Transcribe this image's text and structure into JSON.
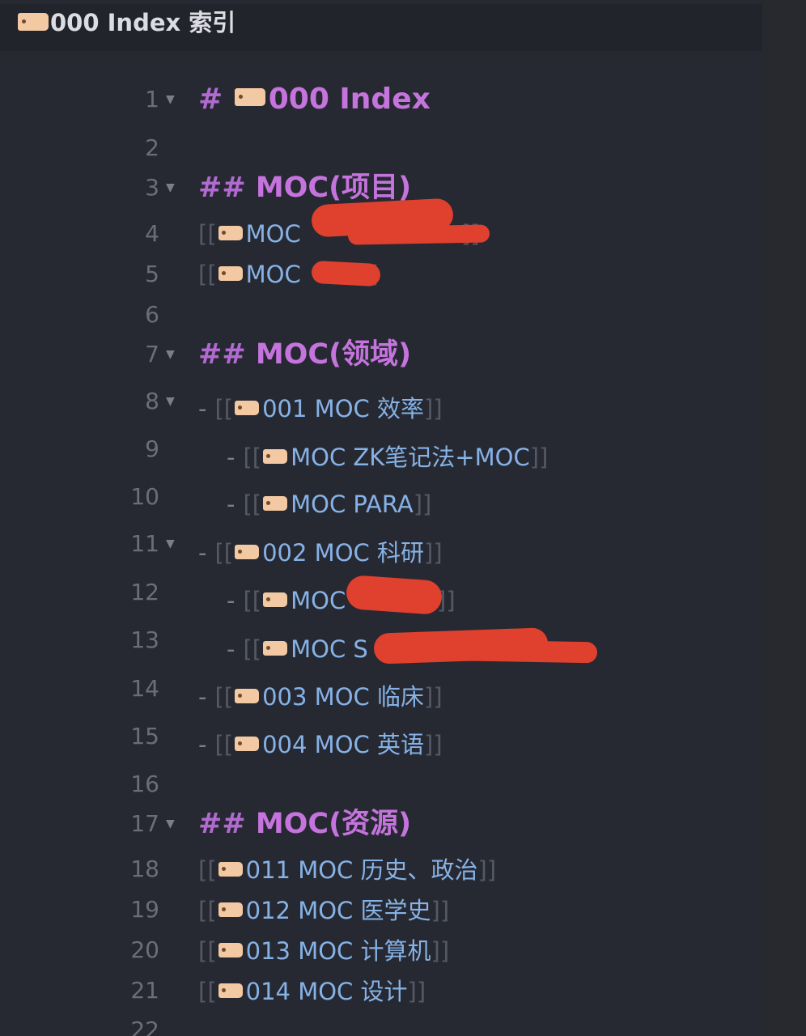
{
  "window": {
    "title": "000 Index 索引"
  },
  "editor": {
    "line_numbers": [
      "1",
      "2",
      "3",
      "4",
      "5",
      "6",
      "7",
      "8",
      "9",
      "10",
      "11",
      "12",
      "13",
      "14",
      "15",
      "16",
      "17",
      "18",
      "19",
      "20",
      "21",
      "22"
    ],
    "h1": {
      "marker": "#",
      "text": "000 Index"
    },
    "h2_projects": {
      "marker": "##",
      "text": "MOC(项目)"
    },
    "h2_domains": {
      "marker": "##",
      "text": "MOC(领域)"
    },
    "h2_resources": {
      "marker": "##",
      "text": "MOC(资源)"
    },
    "bracket_open": "[[",
    "bracket_close": "]]",
    "dash": "-",
    "project_links": [
      "MOC",
      "MOC"
    ],
    "domain_links": [
      "001 MOC 效率",
      "MOC ZK笔记法+MOC",
      "MOC PARA",
      "002 MOC 科研",
      "MOC",
      "MOC S",
      "003 MOC 临床",
      "004 MOC 英语"
    ],
    "resource_links": [
      "011 MOC 历史、政治",
      "012 MOC 医学史",
      "013 MOC 计算机",
      "014 MOC 设计"
    ]
  },
  "colors": {
    "heading": "#c574dd",
    "link": "#86b2e6",
    "redaction": "#e0402e",
    "tag_icon": "#f2c9a2"
  },
  "icons": [
    "tag-icon",
    "fold-arrow-icon"
  ]
}
